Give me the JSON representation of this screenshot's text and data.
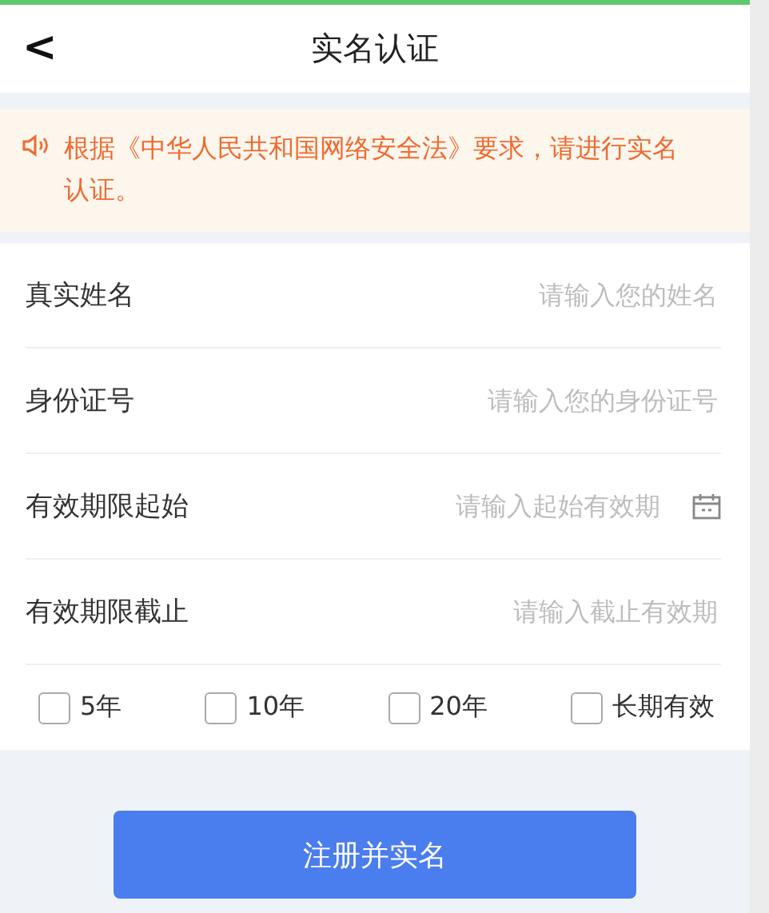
{
  "header": {
    "back": "<",
    "title": "实名认证"
  },
  "notice": {
    "text": "根据《中华人民共和国网络安全法》要求，请进行实名认证。"
  },
  "fields": [
    {
      "kind": "text",
      "label": "真实姓名",
      "placeholder": "请输入您的姓名"
    },
    {
      "kind": "text",
      "label": "身份证号",
      "placeholder": "请输入您的身份证号"
    },
    {
      "kind": "date",
      "label": "有效期限起始",
      "placeholder": "请输入起始有效期"
    },
    {
      "kind": "text",
      "label": "有效期限截止",
      "placeholder": "请输入截止有效期"
    }
  ],
  "periods": [
    {
      "label": "5年",
      "checked": false
    },
    {
      "label": "10年",
      "checked": false
    },
    {
      "label": "20年",
      "checked": false
    },
    {
      "label": "长期有效",
      "checked": false
    }
  ],
  "submit": "注册并实名"
}
